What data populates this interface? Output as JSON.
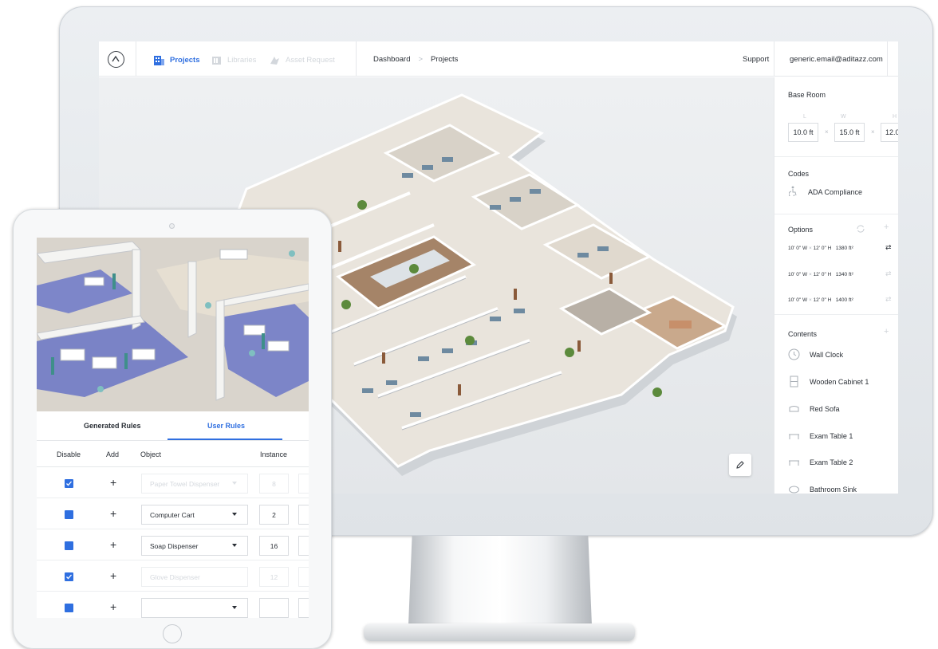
{
  "app": {
    "nav": {
      "projects": "Projects",
      "libraries": "Libraries",
      "asset_request": "Asset Request"
    },
    "breadcrumb": {
      "dashboard": "Dashboard",
      "separator": ">",
      "projects": "Projects"
    },
    "support": "Support",
    "email": "generic.email@aditazz.com",
    "colors": {
      "accent": "#2f6fe0",
      "floor": "#9a7b63",
      "wall": "#ffffff",
      "desk": "#6e8aa0"
    }
  },
  "panel": {
    "base_room": {
      "title": "Base Room",
      "labels": {
        "l": "L",
        "w": "W",
        "h": "H"
      },
      "length": "10.0 ft",
      "width": "15.0 ft",
      "height": "12.0",
      "times": "×"
    },
    "codes": {
      "title": "Codes",
      "items": [
        "ADA Compliance"
      ]
    },
    "options": {
      "title": "Options",
      "rows": [
        {
          "w": "10' 0\" W",
          "h": "12' 0\" H",
          "area": "1380 ft²"
        },
        {
          "w": "10' 0\" W",
          "h": "12' 0\" H",
          "area": "1340 ft²"
        },
        {
          "w": "10' 0\" W",
          "h": "12' 0\" H",
          "area": "1400 ft²"
        }
      ]
    },
    "contents": {
      "title": "Contents",
      "add": "+",
      "items": [
        {
          "label": "Wall Clock",
          "icon": "clock-icon"
        },
        {
          "label": "Wooden Cabinet 1",
          "icon": "cabinet-icon"
        },
        {
          "label": "Red Sofa",
          "icon": "sofa-icon"
        },
        {
          "label": "Exam Table 1",
          "icon": "exam-table-icon"
        },
        {
          "label": "Exam Table 2",
          "icon": "exam-table-icon"
        },
        {
          "label": "Bathroom Sink",
          "icon": "sink-icon"
        }
      ]
    }
  },
  "tablet": {
    "tabs": {
      "generated": "Generated Rules",
      "user": "User Rules"
    },
    "headers": {
      "disable": "Disable",
      "add": "Add",
      "object": "Object",
      "instance": "Instance"
    },
    "plus": "+",
    "rows": [
      {
        "checked": true,
        "object": "Paper Towel Dispenser",
        "instance": "8",
        "disabled": true
      },
      {
        "checked": false,
        "object": "Computer Cart",
        "instance": "2",
        "disabled": false
      },
      {
        "checked": false,
        "object": "Soap Dispenser",
        "instance": "16",
        "disabled": false
      },
      {
        "checked": true,
        "object": "Glove Dispenser",
        "instance": "12",
        "disabled": true
      },
      {
        "checked": false,
        "object": "",
        "instance": "",
        "disabled": false
      }
    ]
  }
}
